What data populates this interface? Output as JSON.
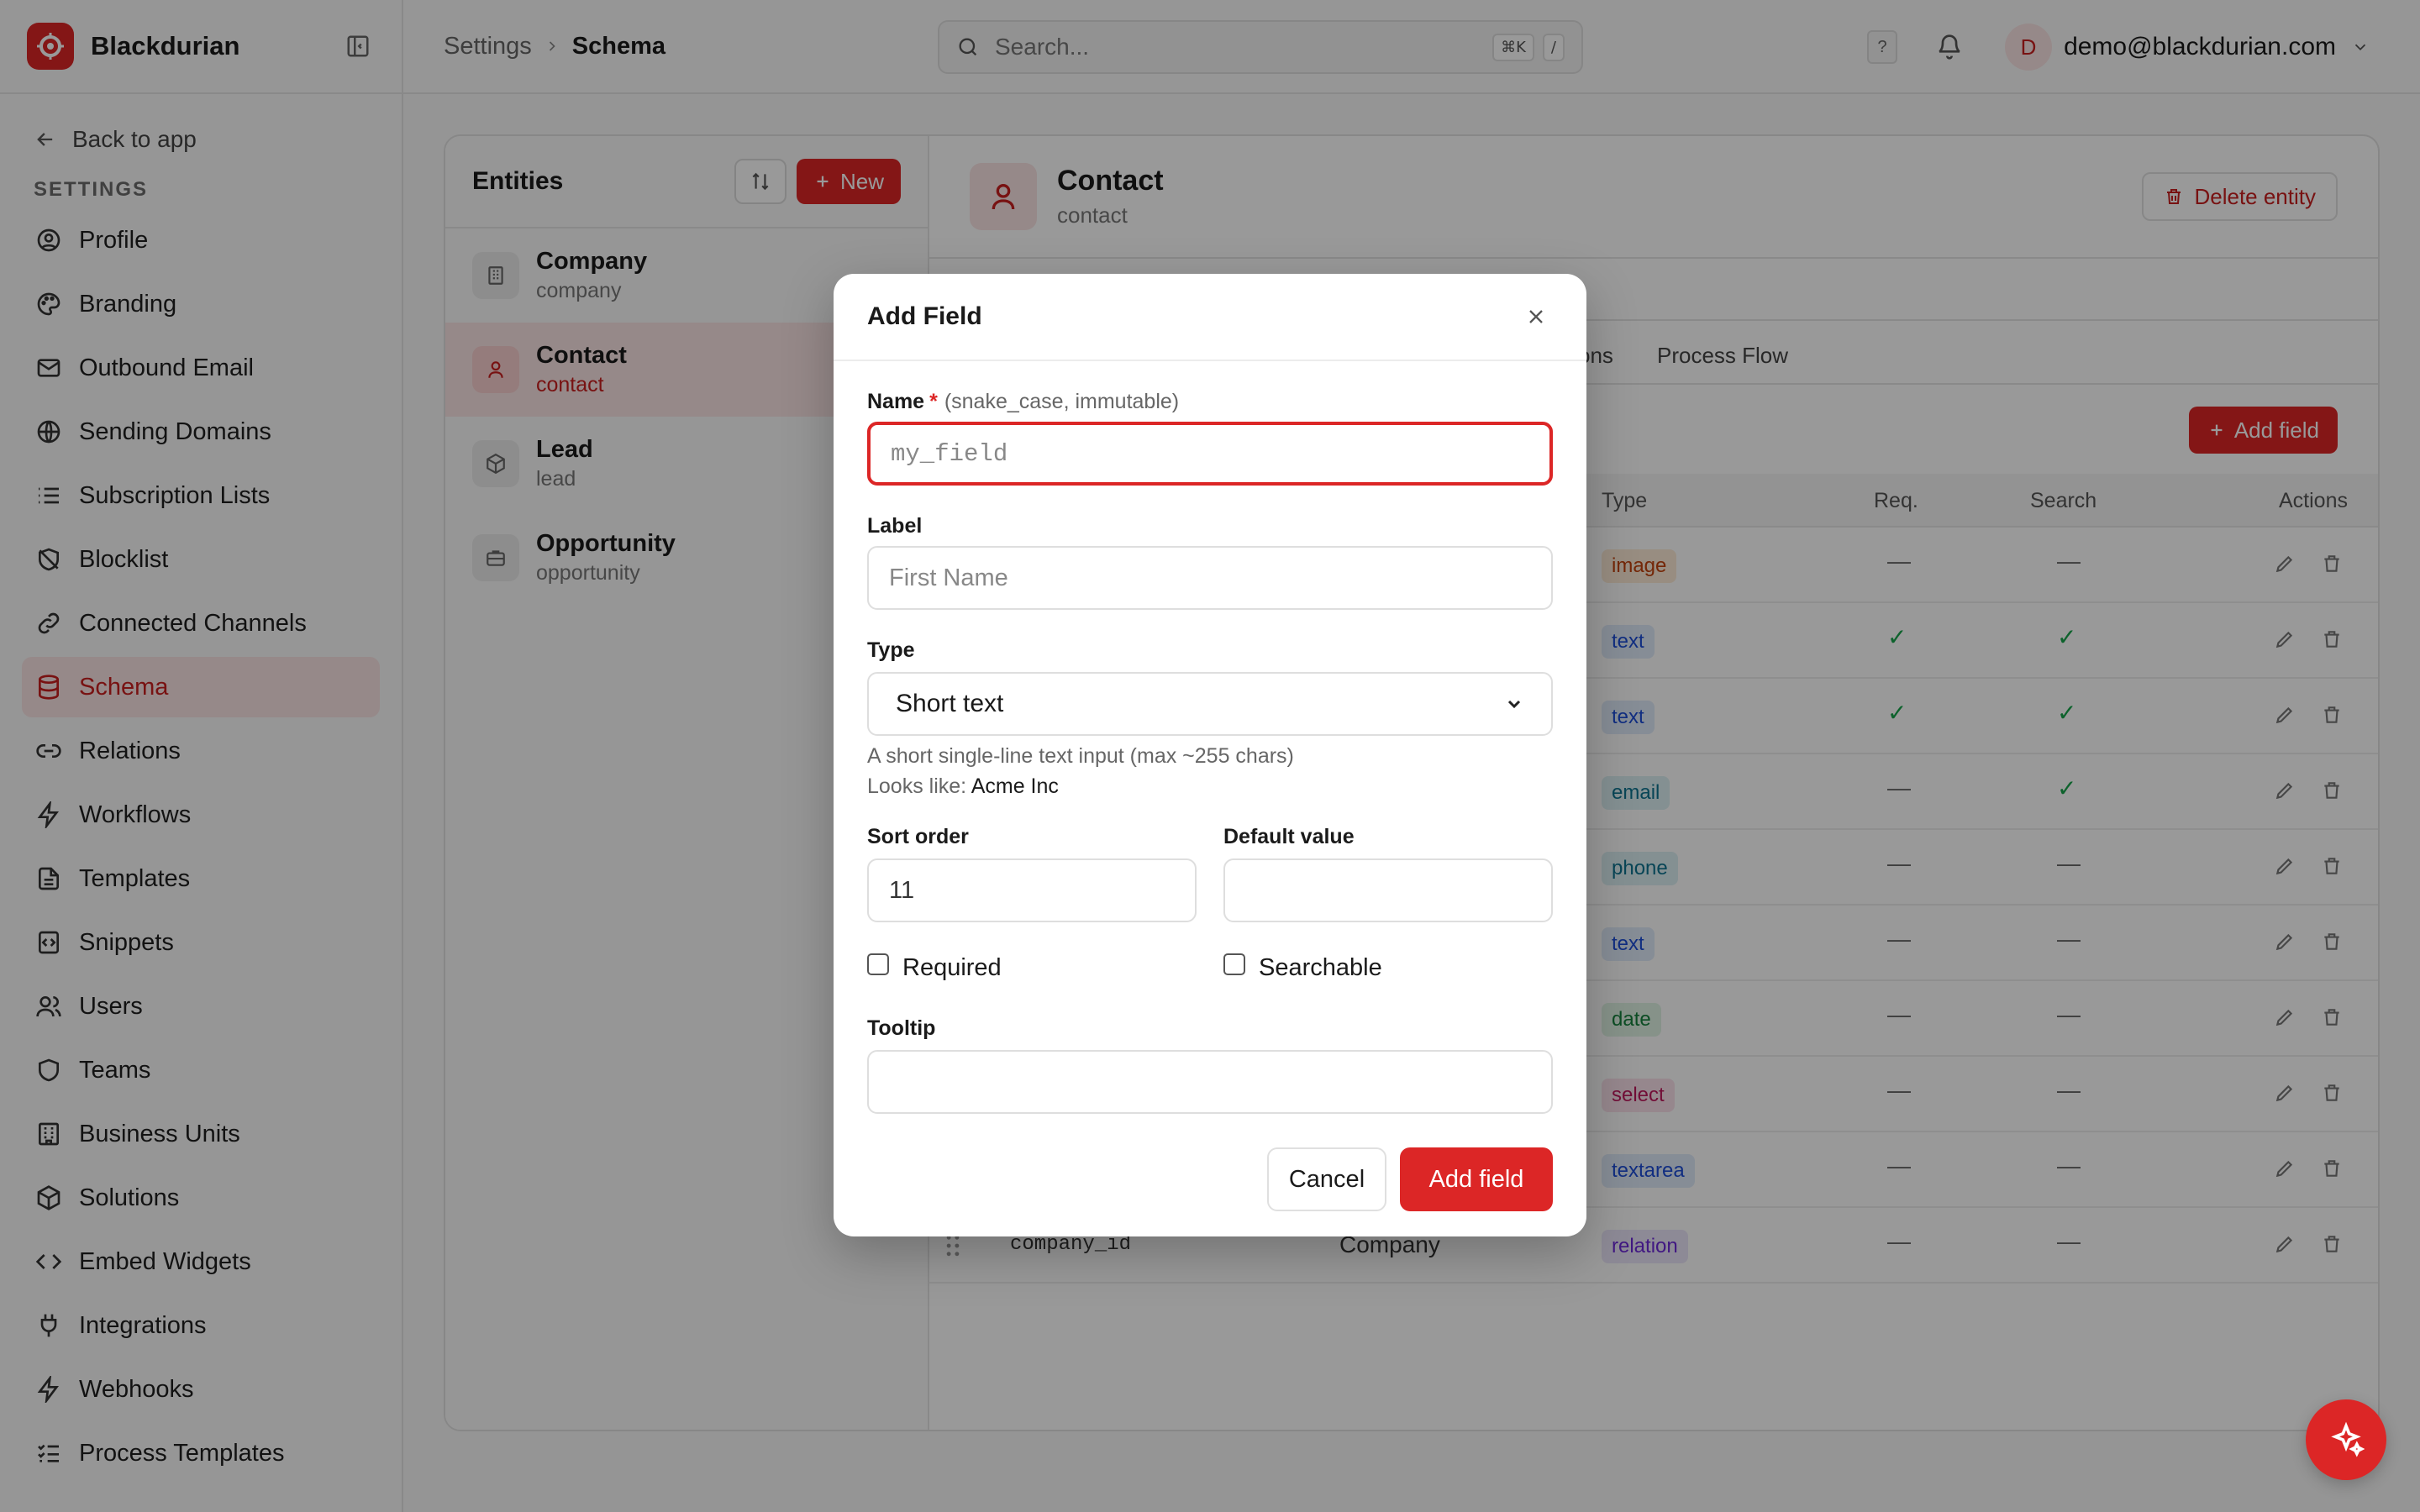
{
  "app": {
    "name": "Blackdurian"
  },
  "sidebar": {
    "back_label": "Back to app",
    "section_label": "SETTINGS",
    "items": [
      {
        "label": "Profile",
        "icon": "user-circle-icon"
      },
      {
        "label": "Branding",
        "icon": "palette-icon"
      },
      {
        "label": "Outbound Email",
        "icon": "mail-icon"
      },
      {
        "label": "Sending Domains",
        "icon": "globe-icon"
      },
      {
        "label": "Subscription Lists",
        "icon": "list-icon"
      },
      {
        "label": "Blocklist",
        "icon": "ban-icon"
      },
      {
        "label": "Connected Channels",
        "icon": "link-icon"
      },
      {
        "label": "Schema",
        "icon": "database-icon",
        "active": true
      },
      {
        "label": "Relations",
        "icon": "link-2-icon"
      },
      {
        "label": "Workflows",
        "icon": "zap-icon"
      },
      {
        "label": "Templates",
        "icon": "file-icon"
      },
      {
        "label": "Snippets",
        "icon": "code-icon"
      },
      {
        "label": "Users",
        "icon": "users-icon"
      },
      {
        "label": "Teams",
        "icon": "shield-icon"
      },
      {
        "label": "Business Units",
        "icon": "building-icon"
      },
      {
        "label": "Solutions",
        "icon": "box-icon"
      },
      {
        "label": "Embed Widgets",
        "icon": "code-brackets-icon"
      },
      {
        "label": "Integrations",
        "icon": "plug-icon"
      },
      {
        "label": "Webhooks",
        "icon": "webhook-icon"
      },
      {
        "label": "Process Templates",
        "icon": "list-checks-icon"
      }
    ]
  },
  "topbar": {
    "breadcrumb": [
      "Settings",
      "Schema"
    ],
    "search_placeholder": "Search...",
    "shortcut": [
      "⌘K",
      "/"
    ],
    "help": "?",
    "avatar_initial": "D",
    "user_email": "demo@blackdurian.com"
  },
  "entities": {
    "title": "Entities",
    "new_label": "New",
    "items": [
      {
        "name": "Company",
        "slug": "company"
      },
      {
        "name": "Contact",
        "slug": "contact",
        "active": true
      },
      {
        "name": "Lead",
        "slug": "lead"
      },
      {
        "name": "Opportunity",
        "slug": "opportunity"
      }
    ]
  },
  "detail": {
    "title": "Contact",
    "slug": "contact",
    "delete_label": "Delete entity",
    "tab_partial": "ons",
    "tab_process_flow": "Process Flow",
    "add_field_label": "Add field",
    "columns": {
      "type": "Type",
      "req": "Req.",
      "search": "Search",
      "actions": "Actions"
    },
    "rows": [
      {
        "type": "image",
        "req": "—",
        "search": "—"
      },
      {
        "type": "text",
        "req": "✓",
        "search": "✓"
      },
      {
        "type": "text",
        "req": "✓",
        "search": "✓"
      },
      {
        "type": "email",
        "req": "—",
        "search": "✓"
      },
      {
        "type": "phone",
        "req": "—",
        "search": "—"
      },
      {
        "type": "text",
        "req": "—",
        "search": "—"
      },
      {
        "type": "date",
        "req": "—",
        "search": "—"
      },
      {
        "type": "select",
        "req": "—",
        "search": "—"
      },
      {
        "type": "textarea",
        "req": "—",
        "search": "—"
      },
      {
        "type": "relation",
        "req": "—",
        "search": "—",
        "name": "company_id",
        "label": "Company"
      }
    ]
  },
  "modal": {
    "title": "Add Field",
    "name_label": "Name",
    "name_required": "*",
    "name_hint": "(snake_case, immutable)",
    "name_placeholder": "my_field",
    "label_label": "Label",
    "label_placeholder": "First Name",
    "type_label": "Type",
    "type_value": "Short text",
    "type_help": "A short single-line text input (max ~255 chars)",
    "looks_like_label": "Looks like:",
    "looks_like_value": "Acme Inc",
    "sort_order_label": "Sort order",
    "sort_order_value": "11",
    "default_value_label": "Default value",
    "default_value_value": "",
    "required_label": "Required",
    "searchable_label": "Searchable",
    "tooltip_label": "Tooltip",
    "tooltip_value": "",
    "cancel_label": "Cancel",
    "submit_label": "Add field"
  },
  "colors": {
    "accent": "#dc2626",
    "accent_soft": "#fbe4e4"
  }
}
